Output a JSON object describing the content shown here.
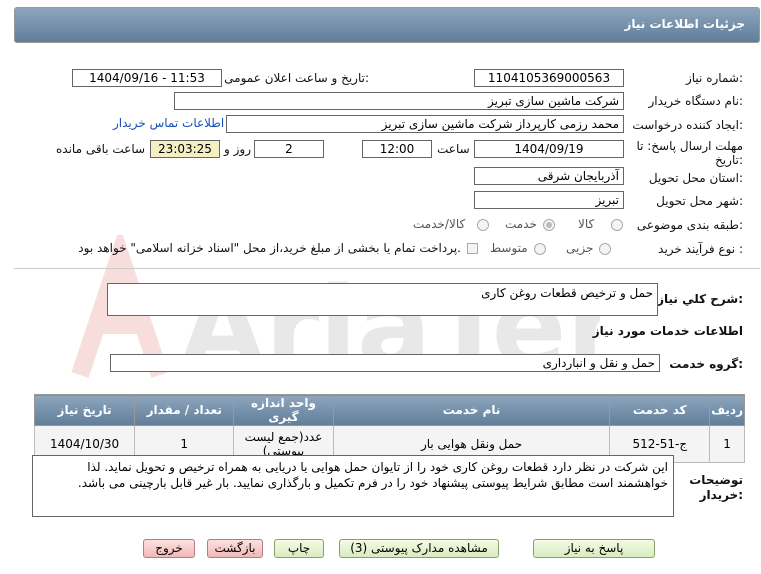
{
  "header": {
    "title": "جزئیات اطلاعات نیاز"
  },
  "form": {
    "need_number_label": "شماره نیاز:",
    "need_number": "1104105369000563",
    "announce_label": "تاریخ و ساعت اعلان عمومی:",
    "announce_value": "1404/09/16 - 11:53",
    "buyer_label": "نام دستگاه خریدار:",
    "buyer_value": "شرکت ماشین سازی تبریز",
    "creator_label": "ایجاد کننده درخواست:",
    "creator_value": "محمد رزمی کارپرداز شرکت ماشین سازی تبریز",
    "contact_link": "اطلاعات تماس خریدار",
    "deadline_label_1": "مهلت ارسال پاسخ: تا",
    "deadline_label_2": "تاریخ:",
    "deadline_date": "1404/09/19",
    "time_label": "ساعت",
    "deadline_time": "12:00",
    "days_value": "2",
    "days_label": "روز و",
    "remaining_time": "23:03:25",
    "remaining_label": "ساعت باقی مانده",
    "province_label": "استان محل تحویل:",
    "province_value": "آذربایجان شرقی",
    "city_label": "شهر محل تحویل:",
    "city_value": "تبریز",
    "category_label": "طبقه بندی موضوعی:",
    "category_options": [
      "کالا",
      "خدمت",
      "کالا/خدمت"
    ],
    "category_selected": "خدمت",
    "process_label": "نوع فرآیند خرید :",
    "process_options": [
      "جزیی",
      "متوسط"
    ],
    "payment_text": "پرداخت تمام یا بخشی از مبلغ خرید،از محل \"اسناد خزانه اسلامی\" خواهد بود."
  },
  "description": {
    "label": "شرح کلي نياز:",
    "value": "حمل و ترخیص قطعات روغن کاری"
  },
  "services": {
    "section_title": "اطلاعات خدمات مورد نیاز",
    "group_label": "گروه خدمت:",
    "group_value": "حمل و نقل و انبارداری",
    "columns": [
      "ردیف",
      "کد خدمت",
      "نام خدمت",
      "واحد اندازه گیری",
      "تعداد / مقدار",
      "تاریخ نیاز"
    ],
    "rows": [
      {
        "row": "1",
        "code": "ج-51-512",
        "name": "حمل ونقل هوایی بار",
        "unit": "عدد(جمع لیست پیوستی)",
        "qty": "1",
        "date": "1404/10/30"
      }
    ]
  },
  "buyer_notes": {
    "label_1": "توضیحات",
    "label_2": "خریدار:",
    "text": "این شرکت در نظر دارد قطعات روغن کاری خود را از تایوان حمل هوایی یا دریایی به همراه ترخیص و تحویل نماید. لذا خواهشمند است مطابق شرایط پیوستی پیشنهاد خود را در فرم تکمیل و بارگذاری نمایید. بار غیر قابل بارچینی می باشد."
  },
  "buttons": {
    "reply": "پاسخ به نیاز",
    "attachments": "مشاهده مدارک پیوستی (3)",
    "print": "چاپ",
    "back": "بازگشت",
    "exit": "خروج"
  },
  "colors": {
    "header": "#607d9a",
    "link": "#1a4fb5",
    "highlight": "#f5f0c4"
  }
}
